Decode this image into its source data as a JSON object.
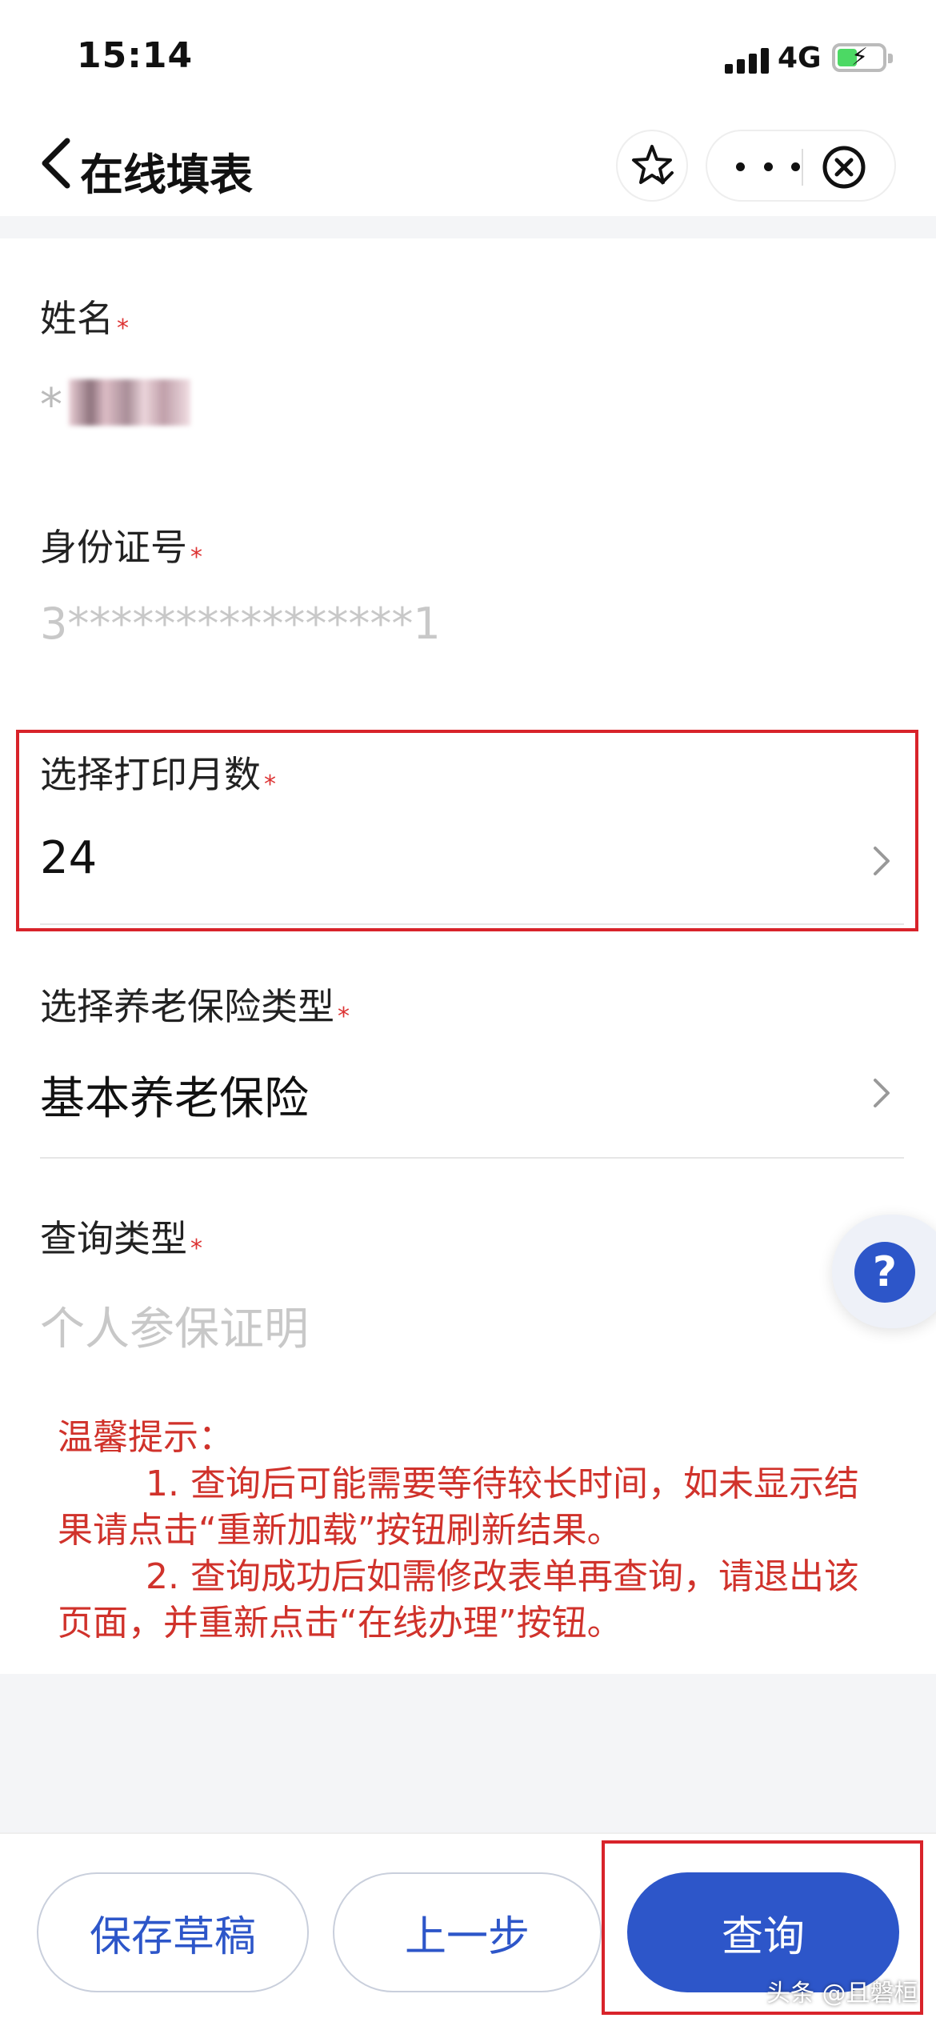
{
  "status_bar": {
    "time": "15:14",
    "network": "4G"
  },
  "nav": {
    "title": "在线填表"
  },
  "form": {
    "required_mark": "*",
    "name": {
      "label": "姓名",
      "value_mask": "*"
    },
    "id_number": {
      "label": "身份证号",
      "value": "3****************1"
    },
    "print_months": {
      "label": "选择打印月数",
      "value": "24"
    },
    "insurance_type": {
      "label": "选择养老保险类型",
      "value": "基本养老保险"
    },
    "query_type": {
      "label": "查询类型",
      "value": "个人参保证明"
    }
  },
  "help": {
    "label": "?"
  },
  "tips": {
    "title": "温馨提示：",
    "line1": "1. 查询后可能需要等待较长时间，如未显示结果请点击“重新加载”按钮刷新结果。",
    "line2": "2. 查询成功后如需修改表单再查询，请退出该页面，并重新点击“在线办理”按钮。"
  },
  "buttons": {
    "save": "保存草稿",
    "prev": "上一步",
    "query": "查询"
  },
  "watermark": "头条 @且磐桓",
  "colors": {
    "accent": "#2d56c9",
    "warning": "#d0322b",
    "highlight": "#d8232a"
  }
}
